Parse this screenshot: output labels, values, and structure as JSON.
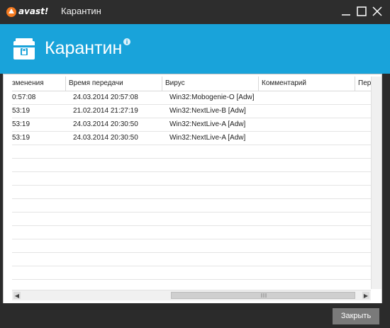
{
  "window": {
    "app_title": "Карантин",
    "logo_text": "avast!",
    "buttons": {
      "minimize_icon": "minimize-icon",
      "maximize_icon": "maximize-icon",
      "close_icon": "close-icon"
    }
  },
  "banner": {
    "title": "Карантин",
    "icon": "quarantine-chest-icon",
    "info_icon": "info-icon",
    "color": "#19a3da"
  },
  "table": {
    "columns": [
      "зменения",
      "Время передачи",
      "Вирус",
      "Комментарий",
      "Пер"
    ],
    "rows": [
      {
        "changed": "0:57:08",
        "sent": "24.03.2014 20:57:08",
        "virus": "Win32:Mobogenie-O [Adw]",
        "comment": ""
      },
      {
        "changed": "53:19",
        "sent": "21.02.2014 21:27:19",
        "virus": "Win32:NextLive-B [Adw]",
        "comment": ""
      },
      {
        "changed": "53:19",
        "sent": "24.03.2014 20:30:50",
        "virus": "Win32:NextLive-A [Adw]",
        "comment": ""
      },
      {
        "changed": "53:19",
        "sent": "24.03.2014 20:30:50",
        "virus": "Win32:NextLive-A [Adw]",
        "comment": ""
      }
    ]
  },
  "footer": {
    "close_label": "Закрыть"
  }
}
